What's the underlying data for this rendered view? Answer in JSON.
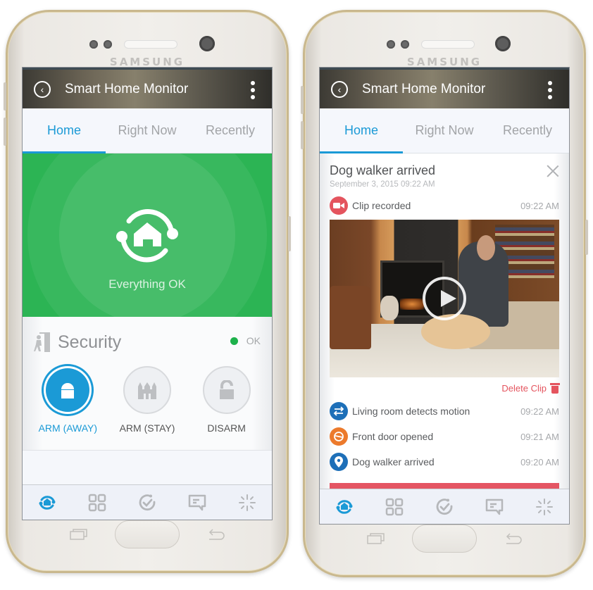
{
  "device": {
    "brand": "SAMSUNG"
  },
  "app": {
    "title": "Smart Home Monitor"
  },
  "tabs": [
    {
      "label": "Home",
      "active": true
    },
    {
      "label": "Right Now",
      "active": false
    },
    {
      "label": "Recently",
      "active": false
    }
  ],
  "left_screen": {
    "status": {
      "text": "Everything OK",
      "color": "#1fb04a"
    },
    "security": {
      "title": "Security",
      "status_label": "OK",
      "status_color": "#1db14b",
      "modes": [
        {
          "label": "ARM (AWAY)",
          "icon": "lock-closed-icon",
          "active": true
        },
        {
          "label": "ARM (STAY)",
          "icon": "castle-icon",
          "active": false
        },
        {
          "label": "DISARM",
          "icon": "lock-open-icon",
          "active": false
        }
      ]
    }
  },
  "right_screen": {
    "activity": {
      "title": "Dog walker arrived",
      "date": "September 3, 2015 09:22 AM",
      "clip": {
        "label": "Clip recorded",
        "time": "09:22 AM",
        "icon": "video-camera-icon",
        "color": "#e4545e"
      },
      "delete_label": "Delete Clip",
      "events": [
        {
          "label": "Living room detects motion",
          "time": "09:22 AM",
          "icon": "motion-arrows-icon",
          "color": "#1d6fb8"
        },
        {
          "label": "Front door opened",
          "time": "09:21 AM",
          "icon": "door-sensor-icon",
          "color": "#ec7a2c"
        },
        {
          "label": "Dog walker arrived",
          "time": "09:20 AM",
          "icon": "location-pin-icon",
          "color": "#1d6fb8"
        }
      ]
    }
  },
  "bottom_nav": [
    {
      "icon": "home-monitor-icon",
      "active": true
    },
    {
      "icon": "grid-icon",
      "active": false
    },
    {
      "icon": "routine-check-icon",
      "active": false
    },
    {
      "icon": "messages-icon",
      "active": false
    },
    {
      "icon": "discover-sparkle-icon",
      "active": false
    }
  ],
  "colors": {
    "accent": "#1b9ad6",
    "danger": "#e4545e",
    "inactive": "#a2a4a7"
  }
}
